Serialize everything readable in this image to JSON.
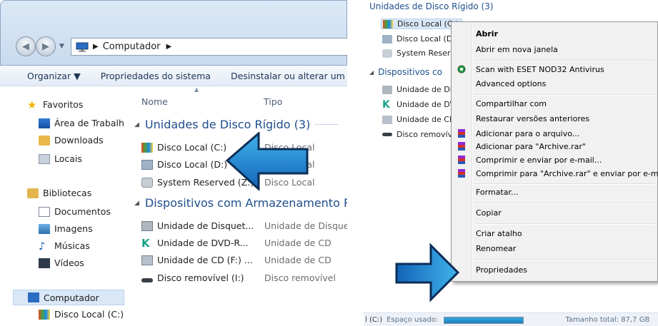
{
  "left": {
    "address": {
      "location": "Computador"
    },
    "toolbar": {
      "organize": "Organizar ▼",
      "properties": "Propriedades do sistema",
      "uninstall": "Desinstalar ou alterar um"
    },
    "nav": {
      "favorites": "Favoritos",
      "desktop": "Área de Trabalh",
      "downloads": "Downloads",
      "places": "Locais",
      "libraries": "Bibliotecas",
      "documents": "Documentos",
      "images": "Imagens",
      "music": "Músicas",
      "videos": "Vídeos",
      "computer": "Computador",
      "local_c": "Disco Local (C:)"
    },
    "columns": {
      "name": "Nome",
      "type": "Tipo"
    },
    "groups": {
      "hdd": "Unidades de Disco Rígido (3)",
      "removable": "Dispositivos com Armazenamento Re"
    },
    "drives": [
      {
        "name": "Disco Local (C:)",
        "type": "Disco Local"
      },
      {
        "name": "Disco Local (D:)",
        "type": "Disco Local"
      },
      {
        "name": "System Reserved (Z:)",
        "type": "Disco Local"
      }
    ],
    "devices": [
      {
        "name": "Unidade de Disquet...",
        "type": "Unidade de Disquet"
      },
      {
        "name": "Unidade de DVD-R...",
        "type": "Unidade de CD"
      },
      {
        "name": "Unidade de CD (F:) ...",
        "type": "Unidade de CD"
      },
      {
        "name": "Disco removível (I:)",
        "type": "Disco removível"
      }
    ]
  },
  "right": {
    "tree": {
      "group_hdd": "Unidades de Disco Rígido (3)",
      "items_hdd": [
        "Disco Local (C:)",
        "Disco Local (D:)",
        "System Reserve"
      ],
      "group_dev": "Dispositivos co",
      "items_dev": [
        "Unidade de Dis",
        "Unidade de DV",
        "Unidade de CD",
        "Disco removíve"
      ]
    },
    "menu": {
      "open": "Abrir",
      "open_new": "Abrir em nova janela",
      "eset": "Scan with ESET NOD32 Antivirus",
      "advanced": "Advanced options",
      "share": "Compartilhar com",
      "restore": "Restaurar versões anteriores",
      "add_archive": "Adicionar para o arquivo...",
      "add_rar": "Adicionar para \"Archive.rar\"",
      "compress_email": "Comprimir e enviar por e-mail...",
      "compress_rar_email": "Comprimir para \"Archive.rar\" e enviar por e-mail",
      "format": "Formatar...",
      "copy": "Copiar",
      "shortcut": "Criar atalho",
      "rename": "Renomear",
      "properties": "Propriedades"
    },
    "status": {
      "prefix": "l (C:)",
      "used": "Espaço usado:",
      "total": "Tamanho total: 87,7 GB"
    }
  }
}
